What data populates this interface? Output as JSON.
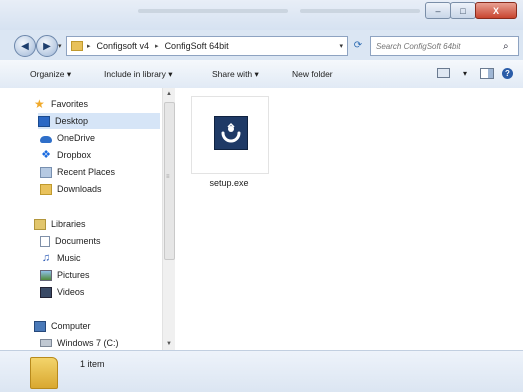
{
  "window": {
    "controls": {
      "minimize": "–",
      "maximize": "□",
      "close": "X"
    }
  },
  "address": {
    "back_glyph": "◀",
    "forward_glyph": "▶",
    "crumbs": [
      "Configsoft v4",
      "ConfigSoft 64bit"
    ],
    "separator": "▸",
    "dropdown_glyph": "▾",
    "refresh_glyph": "⟳"
  },
  "search": {
    "placeholder": "Search ConfigSoft 64bit",
    "icon_glyph": "⌕"
  },
  "toolbar": {
    "organize": "Organize ▾",
    "include": "Include in library ▾",
    "share": "Share with ▾",
    "new_folder": "New folder",
    "view_drop": "▾",
    "help": "?"
  },
  "nav": {
    "favorites": {
      "label": "Favorites",
      "icon": "star-icon"
    },
    "desktop": {
      "label": "Desktop",
      "icon": "desktop-icon"
    },
    "onedrive": {
      "label": "OneDrive",
      "icon": "cloud-icon"
    },
    "dropbox": {
      "label": "Dropbox",
      "icon": "dropbox-icon"
    },
    "recent": {
      "label": "Recent Places",
      "icon": "recent-places-icon"
    },
    "downloads": {
      "label": "Downloads",
      "icon": "downloads-icon"
    },
    "libraries": {
      "label": "Libraries",
      "icon": "libraries-icon"
    },
    "documents": {
      "label": "Documents",
      "icon": "document-icon"
    },
    "music": {
      "label": "Music",
      "icon": "music-icon"
    },
    "pictures": {
      "label": "Pictures",
      "icon": "pictures-icon"
    },
    "videos": {
      "label": "Videos",
      "icon": "videos-icon"
    },
    "computer": {
      "label": "Computer",
      "icon": "computer-icon"
    },
    "drive": {
      "label": "Windows 7 (C:)",
      "icon": "drive-icon"
    },
    "scroll_up": "▲",
    "scroll_down": "▼",
    "grip": "≡"
  },
  "content": {
    "file": {
      "name": "setup.exe",
      "icon": "installer-icon"
    }
  },
  "status": {
    "item_count": "1 item"
  },
  "colors": {
    "selection": "#d6e5f7",
    "chrome": "#dbe6f3",
    "accent": "#2a67c4"
  }
}
